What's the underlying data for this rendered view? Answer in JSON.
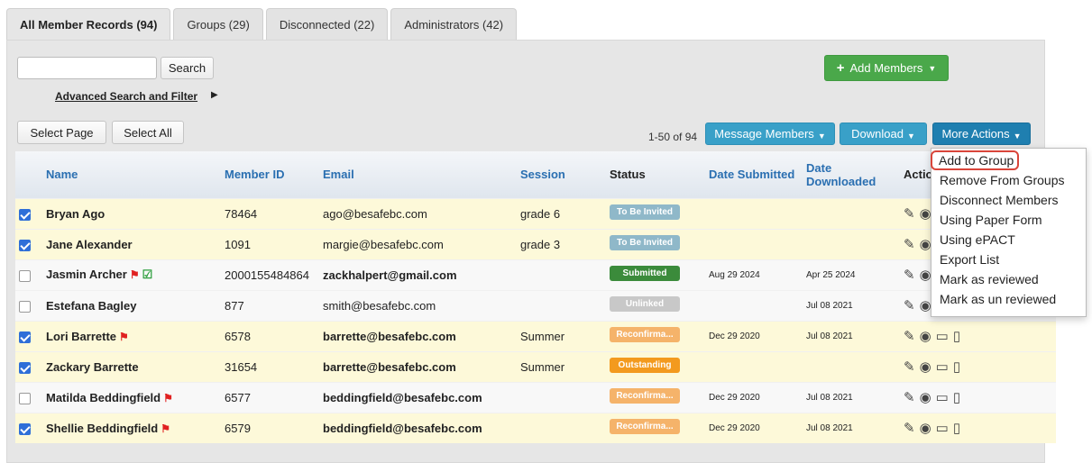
{
  "tabs": [
    {
      "label": "All Member Records (94)"
    },
    {
      "label": "Groups (29)"
    },
    {
      "label": "Disconnected (22)"
    },
    {
      "label": "Administrators (42)"
    }
  ],
  "search": {
    "value": "",
    "button": "Search"
  },
  "advanced_link": "Advanced Search and Filter",
  "add_members": "Add Members",
  "select_page": "Select Page",
  "select_all": "Select All",
  "pager": "1-50 of 94",
  "toolbar": {
    "message": "Message Members",
    "download": "Download",
    "more": "More Actions"
  },
  "columns": {
    "name": "Name",
    "member_id": "Member ID",
    "email": "Email",
    "session": "Session",
    "status": "Status",
    "date_submitted": "Date Submitted",
    "date_downloaded_1": "Date",
    "date_downloaded_2": "Downloaded",
    "actions": "Actio"
  },
  "rows": [
    {
      "checked": true,
      "name": "Bryan Ago",
      "flag": false,
      "verified": false,
      "id": "78464",
      "email": "ago@besafebc.com",
      "email_bold": false,
      "session": "grade 6",
      "status": "To Be Invited",
      "status_color": "#8fb8c9",
      "submitted": "",
      "downloaded": ""
    },
    {
      "checked": true,
      "name": "Jane Alexander",
      "flag": false,
      "verified": false,
      "id": "1091",
      "email": "margie@besafebc.com",
      "email_bold": false,
      "session": "grade 3",
      "status": "To Be Invited",
      "status_color": "#8fb8c9",
      "submitted": "",
      "downloaded": ""
    },
    {
      "checked": false,
      "name": "Jasmin Archer",
      "flag": true,
      "verified": true,
      "id": "2000155484864",
      "email": "zackhalpert@gmail.com",
      "email_bold": true,
      "session": "",
      "status": "Submitted",
      "status_color": "#3b8b3b",
      "submitted": "Aug 29 2024",
      "downloaded": "Apr 25 2024"
    },
    {
      "checked": false,
      "name": "Estefana Bagley",
      "flag": false,
      "verified": false,
      "id": "877",
      "email": "smith@besafebc.com",
      "email_bold": false,
      "session": "",
      "status": "Unlinked",
      "status_color": "#c8c8c8",
      "submitted": "",
      "downloaded": "Jul 08 2021"
    },
    {
      "checked": true,
      "name": "Lori Barrette",
      "flag": true,
      "verified": false,
      "id": "6578",
      "email": "barrette@besafebc.com",
      "email_bold": true,
      "session": "Summer",
      "status": "Reconfirma...",
      "status_color": "#f5b36a",
      "submitted": "Dec 29 2020",
      "downloaded": "Jul 08 2021"
    },
    {
      "checked": true,
      "name": "Zackary Barrette",
      "flag": false,
      "verified": false,
      "id": "31654",
      "email": "barrette@besafebc.com",
      "email_bold": true,
      "session": "Summer",
      "status": "Outstanding",
      "status_color": "#f39a1e",
      "submitted": "",
      "downloaded": ""
    },
    {
      "checked": false,
      "name": "Matilda Beddingfield",
      "flag": true,
      "verified": false,
      "id": "6577",
      "email": "beddingfield@besafebc.com",
      "email_bold": true,
      "session": "",
      "status": "Reconfirma...",
      "status_color": "#f5b36a",
      "submitted": "Dec 29 2020",
      "downloaded": "Jul 08 2021"
    },
    {
      "checked": true,
      "name": "Shellie Beddingfield",
      "flag": true,
      "verified": false,
      "id": "6579",
      "email": "beddingfield@besafebc.com",
      "email_bold": true,
      "session": "",
      "status": "Reconfirma...",
      "status_color": "#f5b36a",
      "submitted": "Dec 29 2020",
      "downloaded": "Jul 08 2021"
    }
  ],
  "menu": [
    "Add to Group",
    "Remove From Groups",
    "Disconnect Members",
    "Using Paper Form",
    "Using ePACT",
    "Export List",
    "Mark as reviewed",
    "Mark as un reviewed"
  ]
}
